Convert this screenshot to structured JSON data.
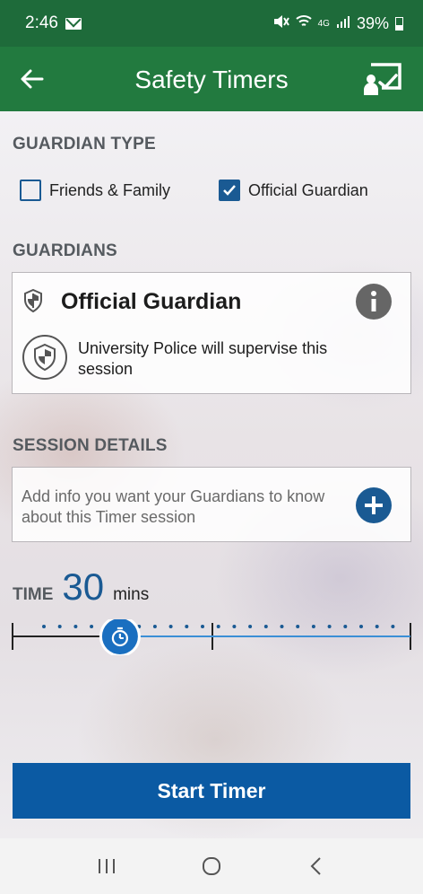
{
  "status_bar": {
    "time": "2:46",
    "network": "4G",
    "battery": "39%",
    "icons": [
      "mail-icon",
      "mute-icon",
      "wifi-icon",
      "signal-icon",
      "battery-icon"
    ]
  },
  "app_bar": {
    "title": "Safety Timers",
    "back_icon": "arrow-left-icon",
    "action_icon": "check-in-icon"
  },
  "guardian_type": {
    "label": "GUARDIAN TYPE",
    "options": [
      {
        "label": "Friends & Family",
        "checked": false
      },
      {
        "label": "Official Guardian",
        "checked": true
      }
    ]
  },
  "guardians": {
    "label": "GUARDIANS",
    "card": {
      "title": "Official Guardian",
      "description": "University Police will supervise this session",
      "icons": [
        "shield-icon",
        "info-icon"
      ]
    }
  },
  "session_details": {
    "label": "SESSION DETAILS",
    "placeholder": "Add info you want your Guardians to know about this Timer session",
    "add_icon": "plus-icon"
  },
  "time": {
    "label": "TIME",
    "value": "30",
    "unit": "mins",
    "slider_fraction": 0.27
  },
  "start_button": {
    "label": "Start Timer"
  },
  "nav_bar": {
    "icons": [
      "recent-apps-icon",
      "home-icon",
      "back-icon"
    ]
  },
  "colors": {
    "status_bar": "#1e6b3a",
    "app_bar": "#227a3f",
    "accent_blue": "#1a5a93",
    "button_blue": "#0b5aa3"
  }
}
